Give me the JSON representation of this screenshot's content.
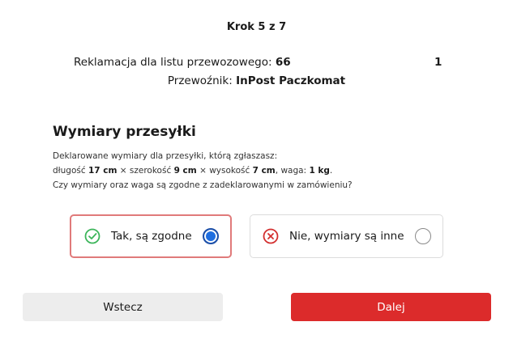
{
  "step": {
    "label": "Krok 5 z 7"
  },
  "claim": {
    "label": "Reklamacja dla listu przewozowego:",
    "number": "66",
    "count": "1"
  },
  "carrier": {
    "label": "Przewoźnik:",
    "name": "InPost Paczkomat"
  },
  "section": {
    "title": "Wymiary przesyłki",
    "intro": "Deklarowane wymiary dla przesyłki, którą zgłaszasz:",
    "length_label": "długość",
    "length_value": "17 cm",
    "sep1": "× szerokość",
    "width_value": "9 cm",
    "sep2": "× wysokość",
    "height_value": "7 cm",
    "weight_label": ", waga:",
    "weight_value": "1 kg",
    "end": ".",
    "question": "Czy wymiary oraz waga są zgodne z zadeklarowanymi w zamówieniu?"
  },
  "options": [
    {
      "label": "Tak, są zgodne",
      "selected": true,
      "icon": "check-circle-icon",
      "color": "#3cb55a"
    },
    {
      "label": "Nie, wymiary są inne",
      "selected": false,
      "icon": "x-circle-icon",
      "color": "#d32f2f"
    }
  ],
  "buttons": {
    "back": "Wstecz",
    "next": "Dalej"
  },
  "colors": {
    "accent": "#dc2b2b",
    "selected_border": "#e07a7a",
    "radio_selected": "#1f6ee0"
  }
}
